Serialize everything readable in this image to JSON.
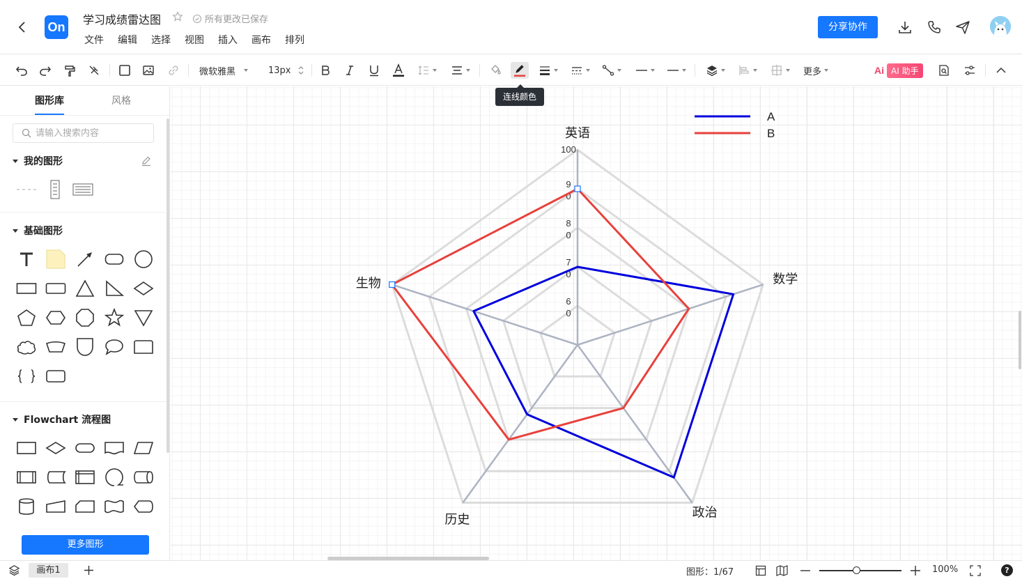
{
  "header": {
    "logo": "On",
    "title": "学习成绩雷达图",
    "save_status": "所有更改已保存",
    "menu": [
      "文件",
      "编辑",
      "选择",
      "视图",
      "插入",
      "画布",
      "排列"
    ],
    "share_label": "分享协作"
  },
  "toolbar": {
    "font_family": "微软雅黑",
    "font_size": "13px",
    "more_label": "更多",
    "ai_logo": "Ai",
    "ai_label": "AI 助手",
    "tooltip": "连线颜色"
  },
  "sidebar": {
    "tab_library": "图形库",
    "tab_style": "风格",
    "search_placeholder": "请输入搜索内容",
    "section_mine": "我的图形",
    "section_basic": "基础图形",
    "section_flowchart": "Flowchart 流程图",
    "more_shapes": "更多图形"
  },
  "status": {
    "page_tab": "画布1",
    "shape_count": "图形：1/67",
    "zoom": "100%",
    "help": "?"
  },
  "chart_data": {
    "type": "radar",
    "axes": [
      "英语",
      "数学",
      "政治",
      "历史",
      "生物"
    ],
    "ticks": [
      "100",
      "9\n0",
      "8\n0",
      "7\n0",
      "6\n0"
    ],
    "tick_values": [
      100,
      90,
      80,
      70,
      60
    ],
    "range": [
      50,
      100
    ],
    "series": [
      {
        "name": "A",
        "color": "#0000dd",
        "values": [
          70,
          92,
          92,
          72,
          78
        ]
      },
      {
        "name": "B",
        "color": "#e8413c",
        "values": [
          90,
          80,
          70,
          80,
          100
        ]
      }
    ],
    "legend": "top-right"
  }
}
